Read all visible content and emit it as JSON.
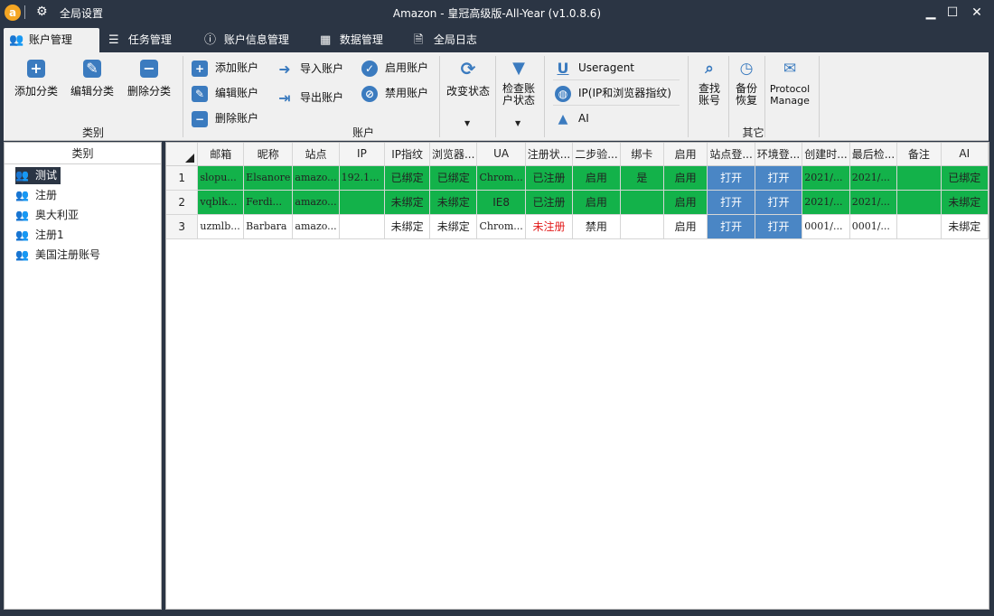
{
  "titlebar": {
    "logo_letter": "a",
    "global_settings": "全局设置",
    "title": "Amazon - 皇冠高级版-All-Year  (v1.0.8.6)",
    "minimize": "▁",
    "maximize": "☐",
    "close": "✕"
  },
  "tabs": [
    {
      "label": "账户管理",
      "icon": "users-icon",
      "glyph": "👥",
      "active": true
    },
    {
      "label": "任务管理",
      "icon": "list-icon",
      "glyph": "☰"
    },
    {
      "label": "账户信息管理",
      "icon": "info-icon",
      "glyph": "ⓘ"
    },
    {
      "label": "数据管理",
      "icon": "grid-icon",
      "glyph": "▦"
    },
    {
      "label": "全局日志",
      "icon": "document-icon",
      "glyph": "🗎"
    }
  ],
  "ribbon": {
    "category_group": {
      "label": "类别",
      "add": "添加分类",
      "edit": "编辑分类",
      "delete": "删除分类"
    },
    "account_group": {
      "label": "账户",
      "add": "添加账户",
      "edit": "编辑账户",
      "delete": "删除账户",
      "import": "导入账户",
      "export": "导出账户",
      "enable": "启用账户",
      "disable": "禁用账户",
      "change_status": "改变状态",
      "check_status_1": "检查账",
      "check_status_2": "户状态"
    },
    "useragent": "Useragent",
    "ip": "IP(IP和浏览器指纹)",
    "ai": "AI",
    "other_group": {
      "label": "其它",
      "find_1": "查找",
      "find_2": "账号",
      "backup_1": "备份",
      "backup_2": "恢复",
      "protocol_1": "Protocol",
      "protocol_2": "Manage"
    }
  },
  "left_panel": {
    "header": "类别",
    "items": [
      {
        "label": "测试",
        "selected": true
      },
      {
        "label": "注册"
      },
      {
        "label": "奥大利亚"
      },
      {
        "label": "注册1"
      },
      {
        "label": "美国注册账号"
      }
    ]
  },
  "grid": {
    "columns": [
      "邮箱",
      "昵称",
      "站点",
      "IP",
      "IP指纹",
      "浏览器...",
      "UA",
      "注册状...",
      "二步验...",
      "绑卡",
      "启用",
      "站点登...",
      "环境登...",
      "创建时...",
      "最后检...",
      "备注",
      "AI"
    ],
    "rows": [
      {
        "num": "1",
        "green": true,
        "cells": [
          "slopu...",
          "Elsanore",
          "amazo...",
          "192.1...",
          "已绑定",
          "已绑定",
          "Chrom...",
          "已注册",
          "启用",
          "是",
          "启用",
          "打开",
          "打开",
          "2021/...",
          "2021/...",
          "",
          "已绑定"
        ]
      },
      {
        "num": "2",
        "green": true,
        "cells": [
          "vqblk...",
          "Ferdi...",
          "amazo...",
          "",
          "未绑定",
          "未绑定",
          "IE8",
          "已注册",
          "启用",
          "",
          "启用",
          "打开",
          "打开",
          "2021/...",
          "2021/...",
          "",
          "未绑定"
        ]
      },
      {
        "num": "3",
        "green": false,
        "cells": [
          "uzmlb...",
          "Barbara",
          "amazo...",
          "",
          "未绑定",
          "未绑定",
          "Chrom...",
          "未注册",
          "禁用",
          "",
          "启用",
          "打开",
          "打开",
          "0001/...",
          "0001/...",
          "",
          "未绑定"
        ]
      }
    ]
  },
  "colors": {
    "titlebar_bg": "#2b3544",
    "row_green": "#13b24a",
    "open_button": "#4a86c5",
    "unregistered_text": "#e31b1b",
    "icon_blue": "#3b7bbf"
  }
}
